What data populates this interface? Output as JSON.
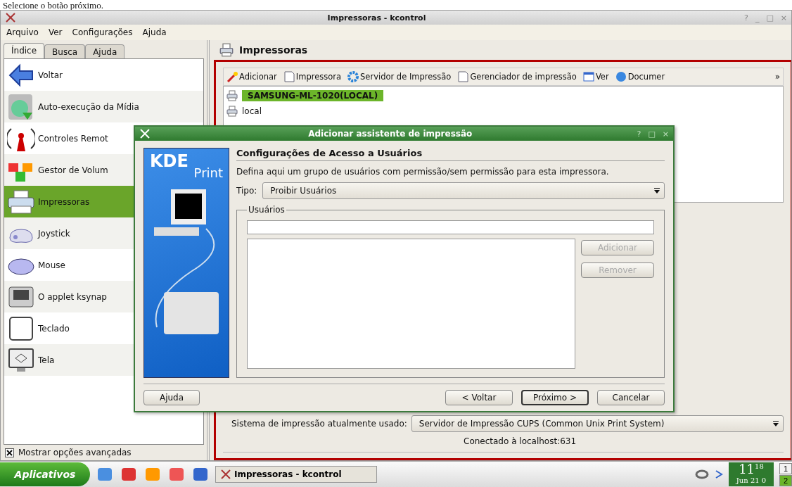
{
  "caption": "Selecione o botão próximo.",
  "window": {
    "title": "Impressoras - kcontrol",
    "controls": [
      "?",
      "_",
      "□",
      "×"
    ]
  },
  "menu": [
    "Arquivo",
    "Ver",
    "Configurações",
    "Ajuda"
  ],
  "sidebar": {
    "tabs": [
      {
        "label": "Índice",
        "selected": true
      },
      {
        "label": "Busca",
        "selected": false
      },
      {
        "label": "Ajuda",
        "selected": false
      }
    ],
    "items": [
      {
        "label": "Voltar",
        "selected": false
      },
      {
        "label": "Auto-execução da Mídia",
        "selected": false
      },
      {
        "label": "Controles Remot",
        "selected": false
      },
      {
        "label": "Gestor de Volum",
        "selected": false
      },
      {
        "label": "Impressoras",
        "selected": true
      },
      {
        "label": "Joystick",
        "selected": false
      },
      {
        "label": "Mouse",
        "selected": false
      },
      {
        "label": "O applet ksynap",
        "selected": false
      },
      {
        "label": "Teclado",
        "selected": false
      },
      {
        "label": "Tela",
        "selected": false
      }
    ],
    "advanced": {
      "label": "Mostrar opções avançadas",
      "checked": true
    }
  },
  "panel": {
    "title": "Impressoras",
    "toolbar": [
      {
        "label": "Adicionar"
      },
      {
        "label": "Impressora"
      },
      {
        "label": "Servidor de Impressão"
      },
      {
        "label": "Gerenciador de impressão"
      },
      {
        "label": "Ver"
      },
      {
        "label": "Documer"
      }
    ],
    "overflow": "»",
    "printers": [
      {
        "name": "SAMSUNG-ML-1020(LOCAL)",
        "selected": true
      },
      {
        "name": "local",
        "selected": false
      }
    ],
    "system_label": "Sistema de impressão atualmente usado:",
    "system_value": "Servidor de Impressão CUPS (Common Unix Print System)",
    "status": "Conectado à localhost:631"
  },
  "dialog": {
    "title": "Adicionar assistente de impressão",
    "controls": [
      "?",
      "□",
      "×"
    ],
    "logo": "KDE",
    "logo_sub": "Print",
    "heading": "Configurações de Acesso a Usuários",
    "description": "Defina aqui um grupo de usuários com permissão/sem permissão para esta impressora.",
    "type_label": "Tipo:",
    "type_value": "Proibir Usuários",
    "group": "Usuários",
    "side_buttons": [
      {
        "label": "Adicionar",
        "disabled": true
      },
      {
        "label": "Remover",
        "disabled": true
      }
    ],
    "buttons": [
      {
        "label": "Ajuda",
        "default": false
      },
      {
        "label": "< Voltar",
        "default": false
      },
      {
        "label": "Próximo >",
        "default": true
      },
      {
        "label": "Cancelar",
        "default": false
      }
    ]
  },
  "taskbar": {
    "start": "Aplicativos",
    "task": "Impressoras - kcontrol",
    "clock_hour": "11",
    "clock_minute": "18",
    "date": "Jun 21 0",
    "desktops": [
      {
        "label": "1",
        "selected": false
      },
      {
        "label": "2",
        "selected": true
      }
    ]
  }
}
